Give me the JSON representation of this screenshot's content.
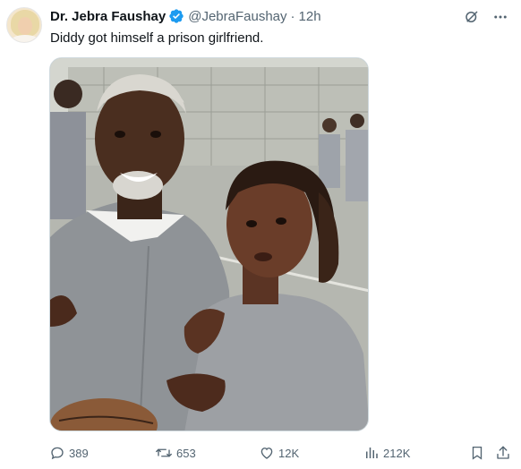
{
  "tweet": {
    "author_name": "Dr. Jebra Faushay",
    "handle": "@JebraFaushay",
    "separator": "·",
    "time": "12h",
    "text": "Diddy got himself a prison girlfriend."
  },
  "stats": {
    "replies": "389",
    "reposts": "653",
    "likes": "12K",
    "views": "212K"
  },
  "colors": {
    "verified": "#1d9bf0",
    "secondary_text": "#536471",
    "primary_text": "#0f1419"
  },
  "icons": {
    "verified": "verified-badge-icon",
    "grok": "grok-icon",
    "more": "more-icon",
    "reply": "reply-icon",
    "repost": "repost-icon",
    "like": "like-icon",
    "views": "views-icon",
    "bookmark": "bookmark-icon",
    "share": "share-icon"
  }
}
